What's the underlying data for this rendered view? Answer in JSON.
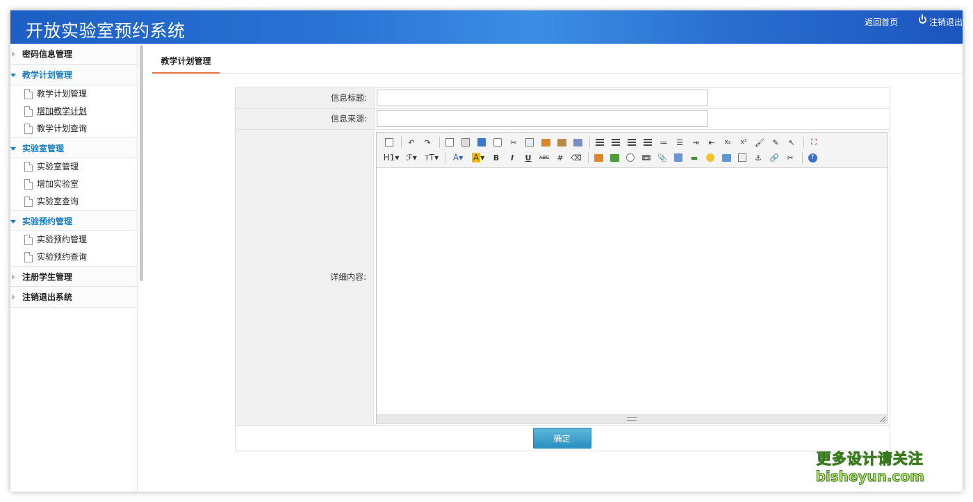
{
  "header": {
    "title": "开放实验室预约系统",
    "home_link": "返回首页",
    "logout_link": "注销退出"
  },
  "sidebar": {
    "groups": [
      {
        "label": "密码信息管理",
        "expanded": false,
        "items": []
      },
      {
        "label": "教学计划管理",
        "expanded": true,
        "items": [
          {
            "label": "教学计划管理"
          },
          {
            "label": "增加教学计划"
          },
          {
            "label": "教学计划查询"
          }
        ]
      },
      {
        "label": "实验室管理",
        "expanded": true,
        "items": [
          {
            "label": "实验室管理"
          },
          {
            "label": "增加实验室"
          },
          {
            "label": "实验室查询"
          }
        ]
      },
      {
        "label": "实验预约管理",
        "expanded": true,
        "items": [
          {
            "label": "实验预约管理"
          },
          {
            "label": "实验预约查询"
          }
        ]
      },
      {
        "label": "注册学生管理",
        "expanded": false,
        "items": []
      },
      {
        "label": "注销退出系统",
        "expanded": false,
        "items": []
      }
    ]
  },
  "main": {
    "tab_label": "教学计划管理",
    "form": {
      "title_label": "信息标题:",
      "title_value": "",
      "source_label": "信息来源:",
      "source_value": "",
      "content_label": "详细内容:",
      "submit_label": "确定"
    },
    "editor": {
      "toolbar_row2_text": {
        "heading": "H1",
        "font_family": "ℱ",
        "font_size": "тT",
        "font_color": "A",
        "bg_color": "A",
        "bold": "B",
        "italic": "I",
        "underline": "U",
        "strike": "ABC"
      }
    }
  },
  "watermark": {
    "line1": "更多设计请关注",
    "line2": "bisheyun.com"
  },
  "colors": {
    "header_blue": "#2a6fd0",
    "active_blue": "#1a7dc1",
    "tab_underline": "#e8743b",
    "button": "#2a8fc0"
  }
}
